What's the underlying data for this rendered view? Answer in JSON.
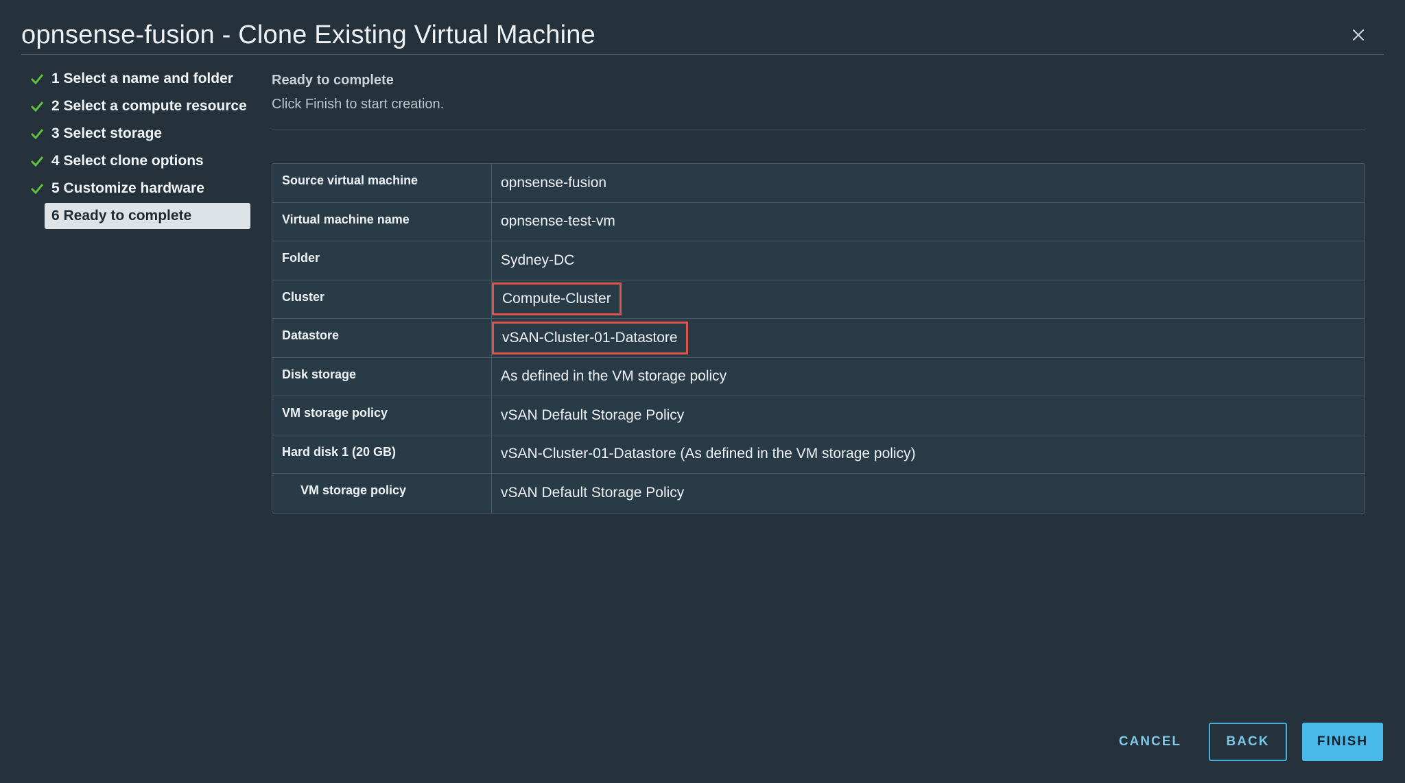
{
  "dialog": {
    "title": "opnsense-fusion - Clone Existing Virtual Machine"
  },
  "steps": [
    {
      "label": "1 Select a name and folder",
      "status": "complete"
    },
    {
      "label": "2 Select a compute resource",
      "status": "complete"
    },
    {
      "label": "3 Select storage",
      "status": "complete"
    },
    {
      "label": "4 Select clone options",
      "status": "complete"
    },
    {
      "label": "5 Customize hardware",
      "status": "complete"
    },
    {
      "label": "6 Ready to complete",
      "status": "active"
    }
  ],
  "content": {
    "title": "Ready to complete",
    "subtitle": "Click Finish to start creation."
  },
  "summary": [
    {
      "label": "Source virtual machine",
      "value": "opnsense-fusion"
    },
    {
      "label": "Virtual machine name",
      "value": "opnsense-test-vm"
    },
    {
      "label": "Folder",
      "value": "Sydney-DC"
    },
    {
      "label": "Cluster",
      "value": "Compute-Cluster",
      "highlighted": true
    },
    {
      "label": "Datastore",
      "value": "vSAN-Cluster-01-Datastore",
      "highlighted": true
    },
    {
      "label": "Disk storage",
      "value": "As defined in the VM storage policy"
    },
    {
      "label": "VM storage policy",
      "value": "vSAN Default Storage Policy"
    },
    {
      "label": "Hard disk 1 (20 GB)",
      "value": "vSAN-Cluster-01-Datastore (As defined in the VM storage policy)"
    },
    {
      "label": "VM storage policy",
      "value": "vSAN Default Storage Policy",
      "indented": true
    }
  ],
  "footer": {
    "cancel_label": "CANCEL",
    "back_label": "BACK",
    "finish_label": "FINISH"
  },
  "colors": {
    "background": "#25323c",
    "check": "#5fbf3f",
    "highlight_border": "#e0554b",
    "primary_button": "#49b9ea"
  }
}
